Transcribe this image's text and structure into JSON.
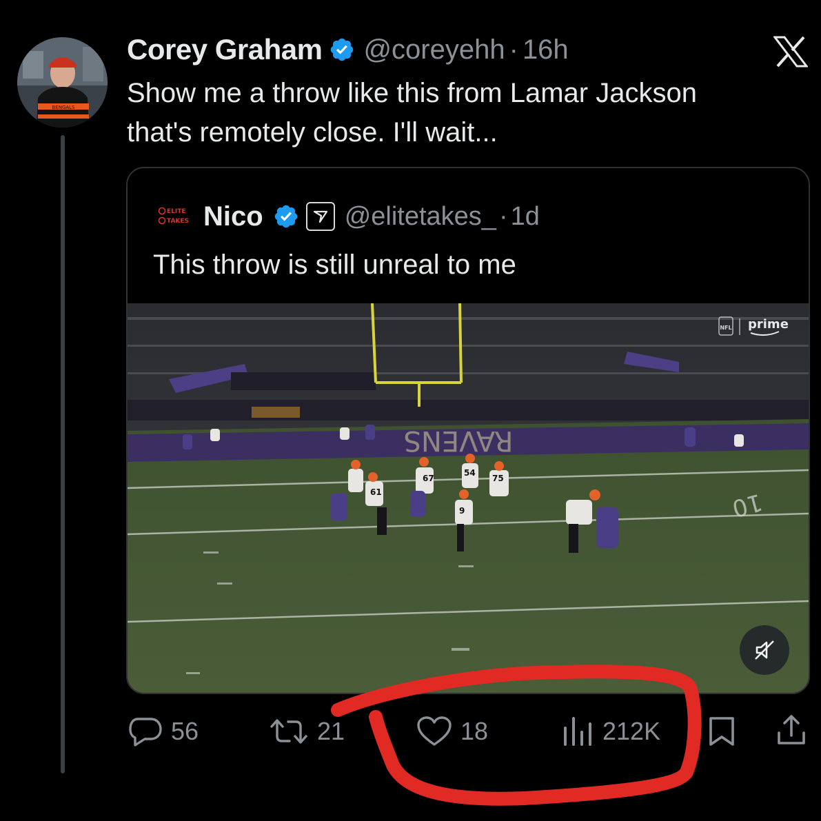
{
  "tweet": {
    "author": {
      "display_name": "Corey Graham",
      "handle": "@coreyehh",
      "separator": "·",
      "timestamp": "16h",
      "verified": true
    },
    "text_line1": "Show me a throw like this from Lamar Jackson",
    "text_line2": "that's remotely close. I'll wait...",
    "avatar_jacket_text": "BENGALS"
  },
  "quote": {
    "author": {
      "logo_line1": "ELITE",
      "logo_line2": "TAKES",
      "display_name": "Nico",
      "handle": "@elitetakes_",
      "separator": "·",
      "timestamp": "1d",
      "verified": true
    },
    "text": "This throw is still unreal to me",
    "video": {
      "broadcaster": "prime",
      "network_logo": "NFL",
      "endzone_text": "RAVENS",
      "yard_marker": "10",
      "jersey_numbers": [
        "67",
        "9",
        "61",
        "75",
        "54"
      ],
      "muted": true
    }
  },
  "actions": {
    "replies": "56",
    "reposts": "21",
    "likes": "18",
    "views": "212K"
  },
  "colors": {
    "background": "#000000",
    "text": "#e7e9ea",
    "secondary": "#8b9197",
    "verified": "#1d9bf0",
    "annotation": "#e02a23"
  },
  "icons": [
    "x-logo-icon",
    "verified-badge-icon",
    "reply-icon",
    "repost-icon",
    "like-icon",
    "views-icon",
    "bookmark-icon",
    "share-icon",
    "mute-icon"
  ]
}
